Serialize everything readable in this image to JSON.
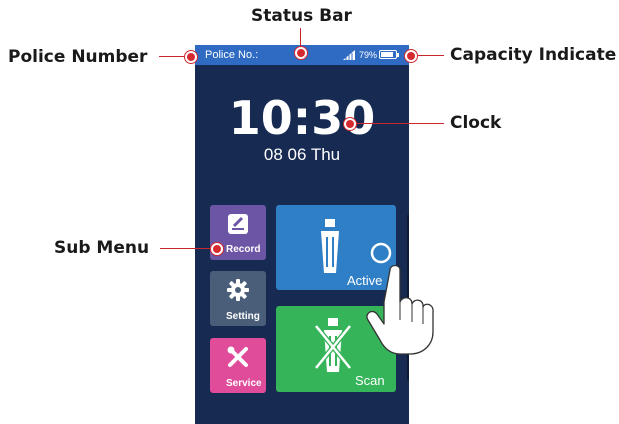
{
  "callouts": {
    "status_bar": "Status Bar",
    "police_number": "Police Number",
    "capacity": "Capacity Indicate",
    "clock": "Clock",
    "sub_menu": "Sub Menu"
  },
  "device": {
    "status_bar": {
      "police_label": "Police No.:",
      "battery_text": "79%"
    },
    "time": "10:30",
    "date": "08 06 Thu",
    "tiles": {
      "record": "Record",
      "setting": "Setting",
      "service": "Service",
      "active": "Active",
      "scan": "Scan"
    }
  },
  "colors": {
    "screen_bg": "#162a52",
    "status_bar": "#2f6bc2",
    "record": "#6d55a6",
    "setting": "#4a5e7a",
    "service": "#e04c9a",
    "active": "#2f7fc6",
    "scan": "#36b45a",
    "callout_dot": "#d42a30"
  },
  "icons": {
    "record": "edit-icon",
    "setting": "gear-icon",
    "service": "tools-icon",
    "active": "breathalyzer-cup-icon",
    "scan": "crossed-cup-icon",
    "hand": "tapping-hand-icon"
  }
}
